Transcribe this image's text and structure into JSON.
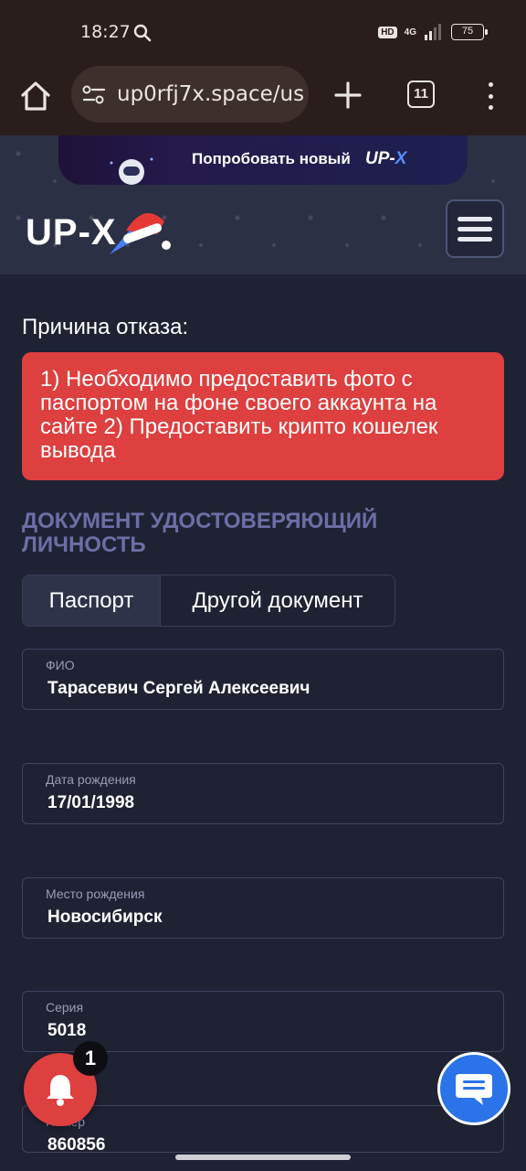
{
  "status_bar": {
    "time": "18:27",
    "hd": "HD",
    "network": "4G",
    "battery": "75"
  },
  "browser": {
    "url": "up0rfj7x.space/us",
    "tab_count": "11"
  },
  "promo": {
    "text": "Попробовать новый",
    "logo_up": "UP-",
    "logo_x": "X"
  },
  "logo": {
    "text": "UP-X"
  },
  "rejection": {
    "label": "Причина отказа:",
    "message": "1) Необходимо предоставить фото с паспортом на фоне своего аккаунта на сайте 2) Предоставить крипто кошелек вывода"
  },
  "document_section": {
    "title": "ДОКУМЕНТ УДОСТОВЕРЯЮЩИЙ ЛИЧНОСТЬ",
    "tabs": [
      {
        "label": "Паспорт",
        "active": true
      },
      {
        "label": "Другой документ",
        "active": false
      }
    ]
  },
  "fields": [
    {
      "label": "ФИО",
      "value": "Тарасевич Сергей Алексеевич"
    },
    {
      "label": "Дата рождения",
      "value": "17/01/1998"
    },
    {
      "label": "Место рождения",
      "value": "Новосибирск"
    },
    {
      "label": "Серия",
      "value": "5018"
    },
    {
      "label": "Номер",
      "value": "860856"
    }
  ],
  "notifications": {
    "count": "1"
  },
  "colors": {
    "accent_red": "#de3f3f",
    "chat_blue": "#2a73e8",
    "section_title": "#6c6fa6",
    "background": "#1f2233"
  }
}
